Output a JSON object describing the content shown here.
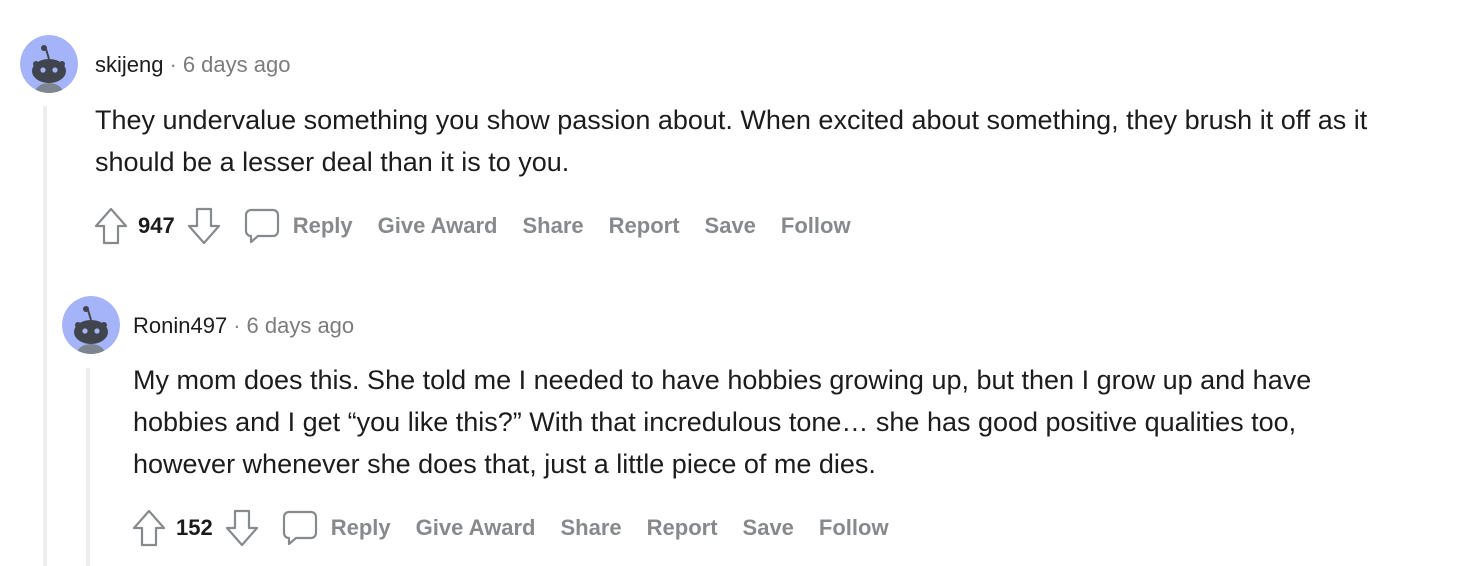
{
  "comments": [
    {
      "username": "skijeng",
      "separator": "·",
      "time": "6 days ago",
      "body": "They undervalue something you show passion about. When excited about something, they brush it off as it should be a lesser deal than it is to you.",
      "score": "947",
      "actions": {
        "reply": "Reply",
        "give_award": "Give Award",
        "share": "Share",
        "report": "Report",
        "save": "Save",
        "follow": "Follow"
      }
    },
    {
      "username": "Ronin497",
      "separator": "·",
      "time": "6 days ago",
      "body": "My mom does this. She told me I needed to have hobbies growing up, but then I grow up and have hobbies and I get “you like this?” With that incredulous tone… she has good positive qualities too, however whenever she does that, just a little piece of me dies.",
      "score": "152",
      "actions": {
        "reply": "Reply",
        "give_award": "Give Award",
        "share": "Share",
        "report": "Report",
        "save": "Save",
        "follow": "Follow"
      }
    }
  ],
  "colors": {
    "avatar_bg": "#a5b4f8",
    "action_gray": "#878a8c",
    "text": "#1c1c1c",
    "thread_line": "#eeeeee"
  },
  "icons": [
    "upvote-icon",
    "downvote-icon",
    "comment-icon",
    "snoo-avatar-icon"
  ]
}
